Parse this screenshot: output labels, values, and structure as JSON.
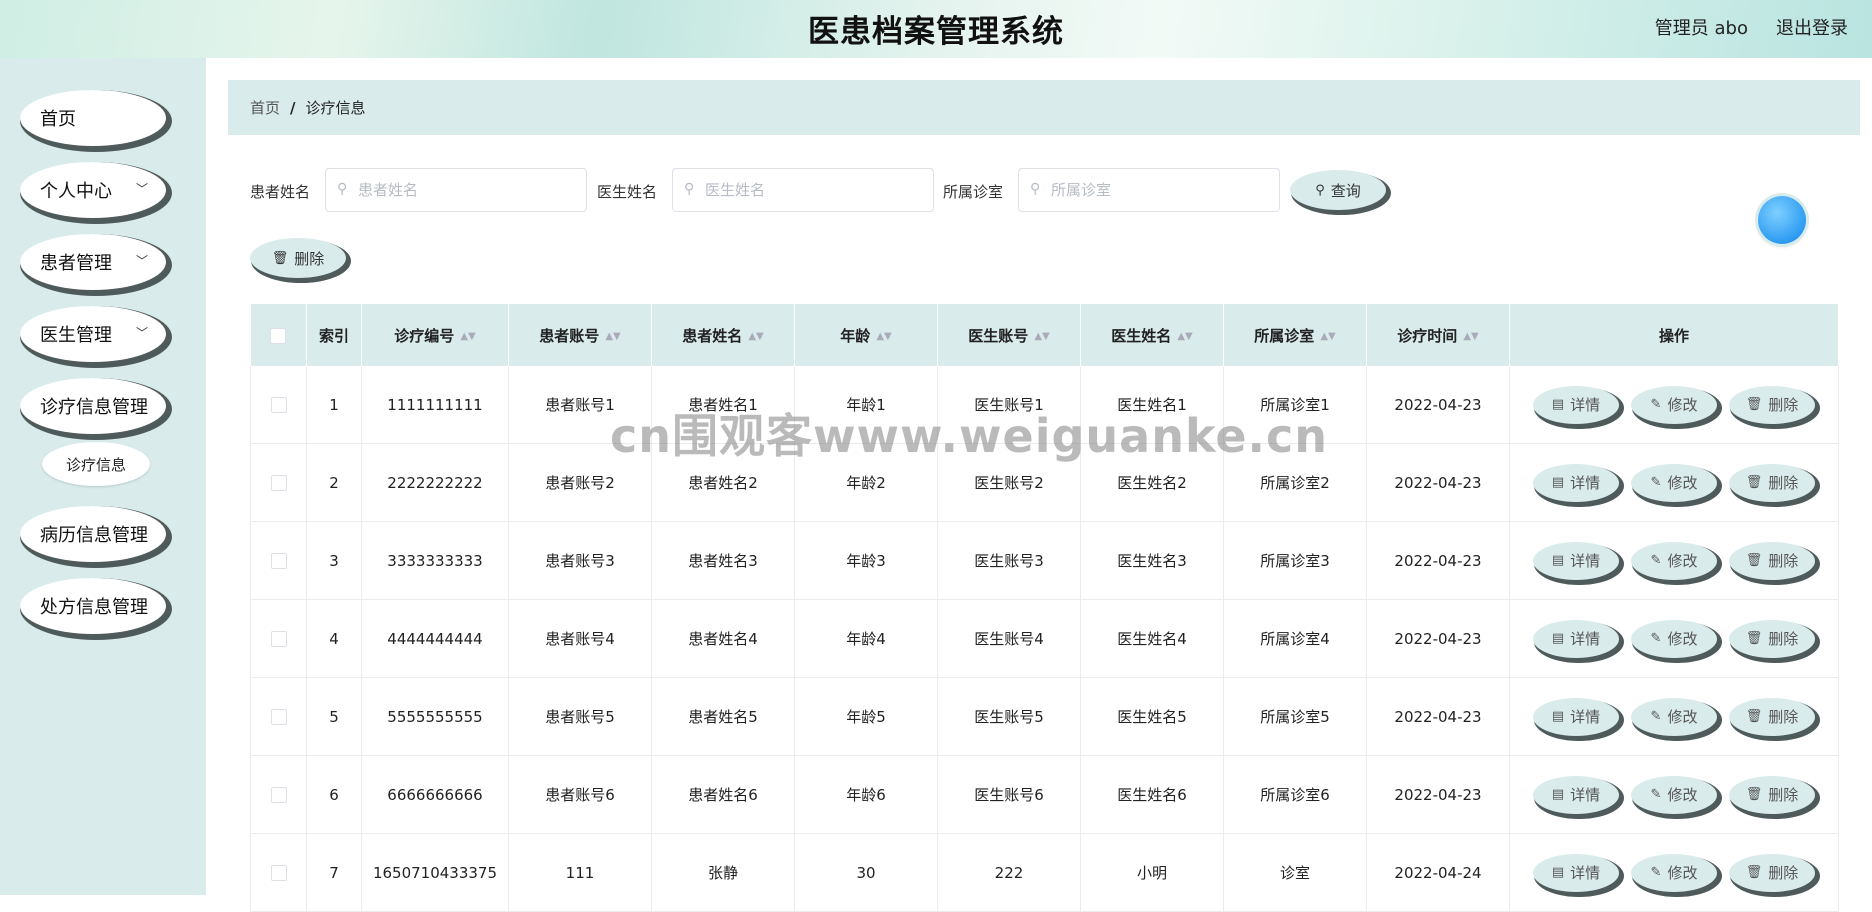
{
  "header": {
    "title": "医患档案管理系统",
    "user": "管理员 abo",
    "logout": "退出登录"
  },
  "sidebar": {
    "items": [
      {
        "label": "首页",
        "chevron": ""
      },
      {
        "label": "个人中心",
        "chevron": "﹀"
      },
      {
        "label": "患者管理",
        "chevron": "﹀"
      },
      {
        "label": "医生管理",
        "chevron": "﹀"
      },
      {
        "label": "诊疗信息管理",
        "chevron": ""
      },
      {
        "label": "病历信息管理",
        "chevron": ""
      },
      {
        "label": "处方信息管理",
        "chevron": ""
      }
    ],
    "subitem": "诊疗信息"
  },
  "breadcrumb": {
    "home": "首页",
    "sep": "/",
    "current": "诊疗信息"
  },
  "search": {
    "patient_name_label": "患者姓名",
    "patient_name_placeholder": "患者姓名",
    "doctor_name_label": "医生姓名",
    "doctor_name_placeholder": "医生姓名",
    "clinic_label": "所属诊室",
    "clinic_placeholder": "所属诊室",
    "query_button": "查询"
  },
  "toolbar": {
    "delete_button": "删除"
  },
  "table": {
    "headers": [
      "索引",
      "诊疗编号",
      "患者账号",
      "患者姓名",
      "年龄",
      "医生账号",
      "医生姓名",
      "所属诊室",
      "诊疗时间",
      "操作"
    ],
    "rows": [
      [
        "1",
        "1111111111",
        "患者账号1",
        "患者姓名1",
        "年龄1",
        "医生账号1",
        "医生姓名1",
        "所属诊室1",
        "2022-04-23"
      ],
      [
        "2",
        "2222222222",
        "患者账号2",
        "患者姓名2",
        "年龄2",
        "医生账号2",
        "医生姓名2",
        "所属诊室2",
        "2022-04-23"
      ],
      [
        "3",
        "3333333333",
        "患者账号3",
        "患者姓名3",
        "年龄3",
        "医生账号3",
        "医生姓名3",
        "所属诊室3",
        "2022-04-23"
      ],
      [
        "4",
        "4444444444",
        "患者账号4",
        "患者姓名4",
        "年龄4",
        "医生账号4",
        "医生姓名4",
        "所属诊室4",
        "2022-04-23"
      ],
      [
        "5",
        "5555555555",
        "患者账号5",
        "患者姓名5",
        "年龄5",
        "医生账号5",
        "医生姓名5",
        "所属诊室5",
        "2022-04-23"
      ],
      [
        "6",
        "6666666666",
        "患者账号6",
        "患者姓名6",
        "年龄6",
        "医生账号6",
        "医生姓名6",
        "所属诊室6",
        "2022-04-23"
      ],
      [
        "7",
        "1650710433375",
        "111",
        "张静",
        "30",
        "222",
        "小明",
        "诊室",
        "2022-04-24"
      ]
    ],
    "actions": {
      "detail": "详情",
      "edit": "修改",
      "delete": "删除"
    }
  },
  "icons": {
    "search": "search-icon",
    "trash": "trash-icon",
    "doc": "document-icon",
    "pencil": "pencil-icon",
    "sort": "sort-icon"
  },
  "watermark": "cn围观客www.weiguanke.cn",
  "colors": {
    "panel": "#d9ebeb",
    "shadow": "#4f5a5b",
    "accent": "#2e9cf2"
  }
}
